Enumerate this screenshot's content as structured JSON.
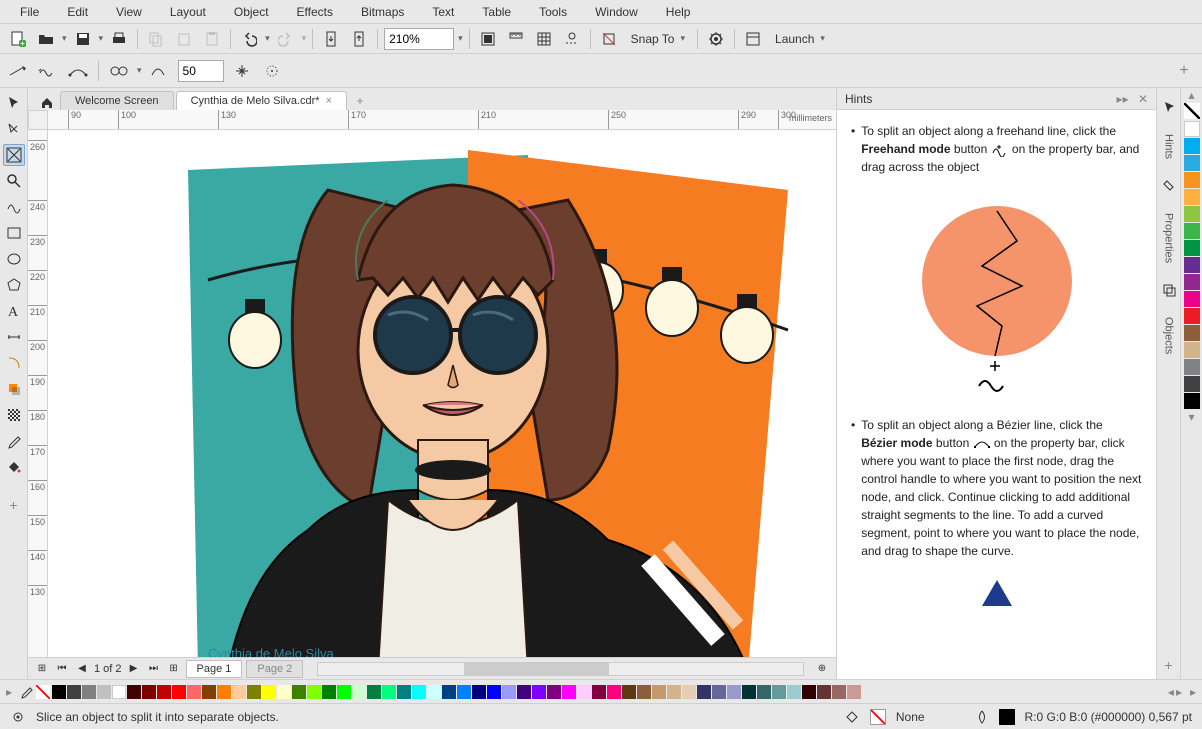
{
  "menu": {
    "items": [
      "File",
      "Edit",
      "View",
      "Layout",
      "Object",
      "Effects",
      "Bitmaps",
      "Text",
      "Table",
      "Tools",
      "Window",
      "Help"
    ]
  },
  "toolbar": {
    "zoom": "210%",
    "snap": "Snap To",
    "launch": "Launch"
  },
  "propbar": {
    "value": "50"
  },
  "tabs": {
    "welcome": "Welcome Screen",
    "file": "Cynthia de Melo Silva.cdr*"
  },
  "ruler": {
    "unit": "millimeters",
    "h": [
      "90",
      "100",
      "130",
      "170",
      "210",
      "250",
      "290",
      "300"
    ],
    "v": [
      "260",
      "240",
      "230",
      "220",
      "210",
      "200",
      "190",
      "180",
      "170",
      "160",
      "150",
      "140",
      "130"
    ]
  },
  "artist": "Cynthia  de Melo Silva",
  "pagebar": {
    "counter": "1  of  2",
    "page1": "Page 1",
    "page2": "Page 2"
  },
  "panel": {
    "title": "Hints",
    "hint1_pre": "To split an object along a freehand line, click the ",
    "hint1_bold": "Freehand mode",
    "hint1_mid": " button ",
    "hint1_post": " on the property bar, and drag across the object",
    "hint2_pre": "To split an object along a Bézier line, click the ",
    "hint2_bold": "Bézier mode",
    "hint2_mid": " button ",
    "hint2_post": " on the property bar, click where you want to place the first node, drag the control handle to where you want to position the next node, and click. Continue clicking to add additional straight segments to the line. To add a curved segment, point to where you want to place the node, and drag to shape the curve."
  },
  "sideTabs": {
    "hints": "Hints",
    "properties": "Properties",
    "objects": "Objects"
  },
  "colors": {
    "strip": [
      "#ffffff",
      "#00aeef",
      "#29abe2",
      "#f7941d",
      "#fbb040",
      "#8dc63f",
      "#39b54a",
      "#009444",
      "#662d91",
      "#92278f",
      "#ec008c",
      "#ed1c24",
      "#8b5e3c",
      "#d2b48c",
      "#808285",
      "#414042",
      "#000000"
    ],
    "palette": [
      "#000000",
      "#404040",
      "#808080",
      "#c0c0c0",
      "#ffffff",
      "#400000",
      "#800000",
      "#c00000",
      "#ff0000",
      "#ff6666",
      "#804000",
      "#ff8000",
      "#ffcc99",
      "#808000",
      "#ffff00",
      "#ffffcc",
      "#408000",
      "#80ff00",
      "#008000",
      "#00ff00",
      "#ccffcc",
      "#008040",
      "#00ff80",
      "#008080",
      "#00ffff",
      "#ccffff",
      "#004080",
      "#0080ff",
      "#000080",
      "#0000ff",
      "#9999ff",
      "#400080",
      "#8000ff",
      "#800080",
      "#ff00ff",
      "#ffccff",
      "#800040",
      "#ff0080",
      "#603913",
      "#8b5e3c",
      "#c49a6c",
      "#d2b48c",
      "#e6ccb3",
      "#333366",
      "#666699",
      "#9999cc",
      "#003333",
      "#336666",
      "#669999",
      "#99cccc",
      "#330000",
      "#663333",
      "#996666",
      "#cc9999"
    ]
  },
  "status": {
    "hint": "Slice an object to split it into separate objects.",
    "fill": "None",
    "outline": "R:0 G:0 B:0 (#000000)  0,567 pt"
  }
}
